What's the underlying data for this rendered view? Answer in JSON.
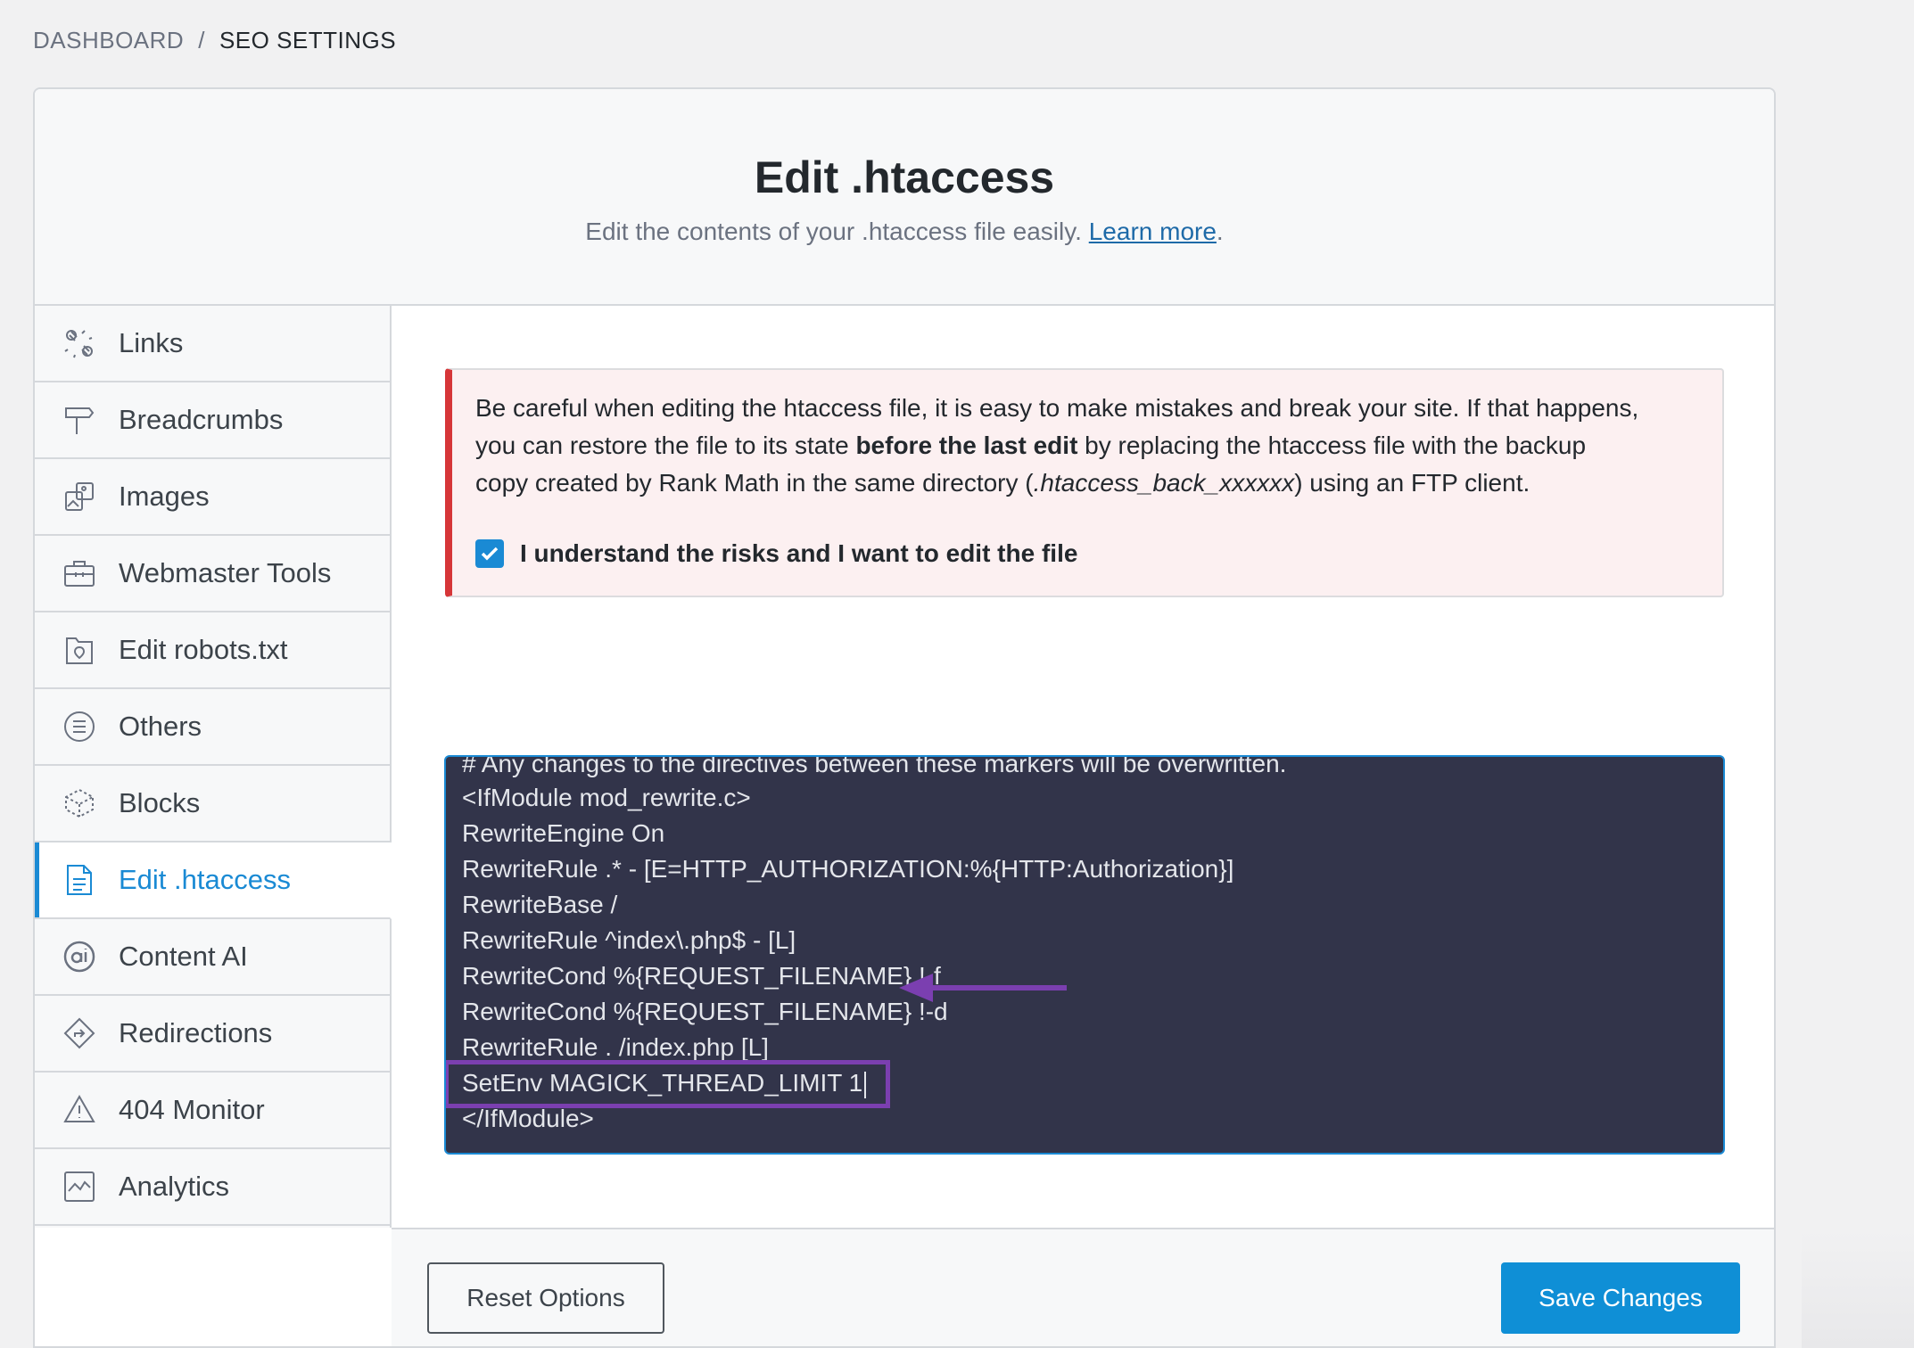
{
  "breadcrumb": {
    "parent": "DASHBOARD",
    "separator": "/",
    "current": "SEO SETTINGS"
  },
  "header": {
    "title": "Edit .htaccess",
    "subtitle": "Edit the contents of your .htaccess file easily.",
    "learn_more": "Learn more",
    "subtitle_end": "."
  },
  "sidebar": {
    "items": [
      {
        "label": "Links",
        "icon": "links-icon"
      },
      {
        "label": "Breadcrumbs",
        "icon": "signpost-icon"
      },
      {
        "label": "Images",
        "icon": "images-icon"
      },
      {
        "label": "Webmaster Tools",
        "icon": "toolbox-icon"
      },
      {
        "label": "Edit robots.txt",
        "icon": "robots-file-icon"
      },
      {
        "label": "Others",
        "icon": "list-circle-icon"
      },
      {
        "label": "Blocks",
        "icon": "blocks-icon"
      },
      {
        "label": "Edit .htaccess",
        "icon": "document-icon",
        "active": true
      },
      {
        "label": "Content AI",
        "icon": "content-ai-icon"
      },
      {
        "label": "Redirections",
        "icon": "redirect-diamond-icon"
      },
      {
        "label": "404 Monitor",
        "icon": "warning-triangle-icon"
      },
      {
        "label": "Analytics",
        "icon": "analytics-chart-icon"
      }
    ]
  },
  "notice": {
    "line1": "Be careful when editing the htaccess file, it is easy to make mistakes and break your site. If that happens,",
    "line2_pre": "you can restore the file to its state ",
    "line2_bold": "before the last edit",
    "line2_post": " by replacing the htaccess file with the backup",
    "line3_pre": "copy created by Rank Math in the same directory (",
    "line3_italic": ".htaccess_back_xxxxxx",
    "line3_post": ") using an FTP client.",
    "checkbox_label": "I understand the risks and I want to edit the file",
    "checkbox_checked": true
  },
  "editor": {
    "lines": [
      "# Any changes to the directives between these markers will be overwritten.",
      "<IfModule mod_rewrite.c>",
      "RewriteEngine On",
      "RewriteRule .* - [E=HTTP_AUTHORIZATION:%{HTTP:Authorization}]",
      "RewriteBase /",
      "RewriteRule ^index\\.php$ - [L]",
      "RewriteCond %{REQUEST_FILENAME} !-f",
      "RewriteCond %{REQUEST_FILENAME} !-d",
      "RewriteRule . /index.php [L]",
      "SetEnv MAGICK_THREAD_LIMIT 1",
      "</IfModule>"
    ],
    "highlight_color": "#7b3fb0"
  },
  "footer": {
    "reset_label": "Reset Options",
    "save_label": "Save Changes"
  },
  "colors": {
    "accent": "#1a8ad4",
    "danger": "#d63638",
    "editor_bg": "#32344a",
    "annotation": "#7b3fb0"
  }
}
